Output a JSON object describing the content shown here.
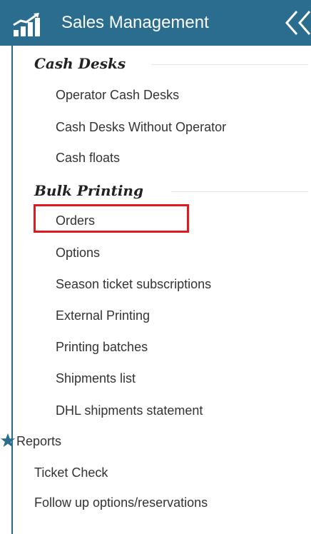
{
  "header": {
    "title": "Sales Management",
    "bg_color": "#2b6d8e"
  },
  "sections": [
    {
      "label": "Cash Desks",
      "items": [
        "Operator Cash Desks",
        "Cash Desks Without Operator",
        "Cash floats"
      ]
    },
    {
      "label": "Bulk Printing",
      "items": [
        "Orders",
        "Options",
        "Season ticket subscriptions",
        "External Printing",
        "Printing batches",
        "Shipments list",
        "DHL shipments statement"
      ]
    }
  ],
  "top_items": [
    "Reports",
    "Ticket Check",
    "Follow up options/reservations"
  ],
  "highlighted_item": "Orders",
  "highlight_color": "#e0191f",
  "icons": {
    "logo": "chart-stairs-icon",
    "collapse": "double-chevron-left-icon",
    "reports": "star-icon"
  }
}
